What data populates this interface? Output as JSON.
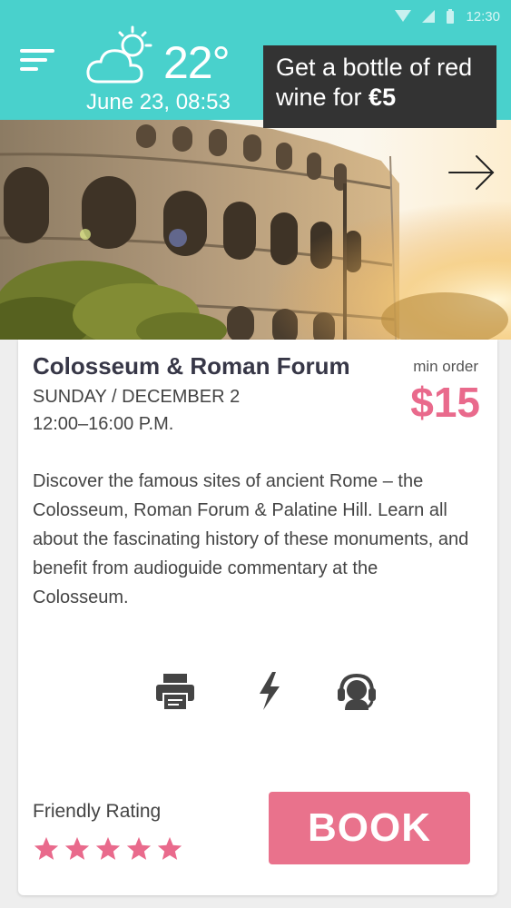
{
  "status": {
    "time": "12:30"
  },
  "header": {
    "temperature": "22°",
    "date": "June 23, 08:53",
    "weather_icon": "partly-cloudy-icon"
  },
  "promo": {
    "text": "Get a bottle of red wine for ",
    "highlight": "€5"
  },
  "tour": {
    "title": "Colosseum & Roman Forum",
    "day": "SUNDAY / DECEMBER 2",
    "hours": "12:00–16:00 P.M.",
    "min_order_label": "min order",
    "price": "$15",
    "description": "Discover the famous sites of ancient Rome – the Colosseum, Roman Forum & Palatine Hill. Learn all about the fascinating history of these monuments, and benefit from audioguide commentary at the Colosseum.",
    "features": [
      "printer-icon",
      "lightning-icon",
      "headset-support-icon"
    ]
  },
  "rating": {
    "label": "Friendly Rating",
    "stars": 5,
    "max": 5
  },
  "book_label": "BOOK",
  "colors": {
    "accent": "#49d1cc",
    "pink": "#e96a8c",
    "dark": "#333333"
  }
}
